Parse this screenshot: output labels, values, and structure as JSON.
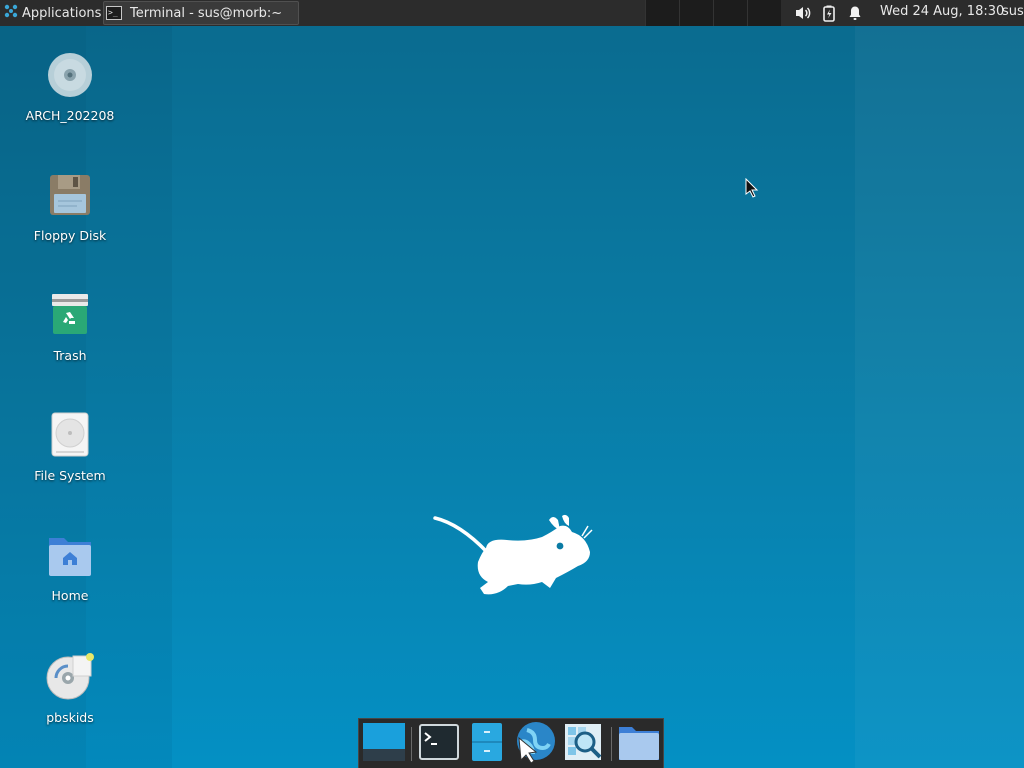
{
  "top_panel": {
    "app_menu_label": "Applications",
    "task_window_title": "Terminal - sus@morb:~",
    "workspace_count": 4,
    "tray_icons": [
      "volume-icon",
      "battery-icon",
      "notification-bell-icon"
    ],
    "clock": "Wed 24 Aug, 18:30",
    "user": "sus"
  },
  "desktop_icons": [
    {
      "label": "ARCH_202208",
      "icon": "optical-disc-icon"
    },
    {
      "label": "Floppy Disk",
      "icon": "floppy-disk-icon"
    },
    {
      "label": "Trash",
      "icon": "trash-icon"
    },
    {
      "label": "File System",
      "icon": "hard-drive-icon"
    },
    {
      "label": "Home",
      "icon": "home-folder-icon"
    },
    {
      "label": "pbskids",
      "icon": "disc-image-icon"
    }
  ],
  "dock_items": [
    "show-desktop-icon",
    "terminal-icon",
    "file-manager-icon",
    "web-browser-icon",
    "app-finder-icon",
    "folder-icon"
  ],
  "colors": {
    "panel": "#2c2c2c",
    "desktop_top": "#0a6a8e",
    "desktop_bottom": "#0490c4",
    "accent": "#1aa0dc"
  }
}
